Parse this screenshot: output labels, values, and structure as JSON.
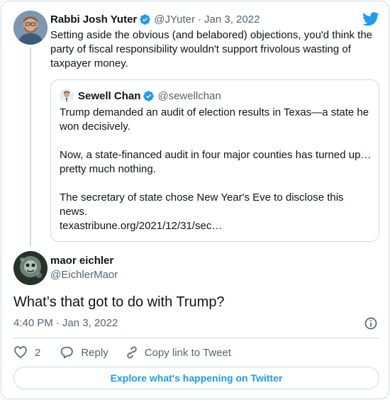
{
  "parent_tweet": {
    "name": "Rabbi Josh Yuter",
    "handle": "@JYuter",
    "separator": "·",
    "date": "Jan 3, 2022",
    "text": "Setting aside the obvious (and belabored) objections, you'd think the party of fiscal responsibility wouldn't support frivolous wasting of taxpayer money."
  },
  "quoted_tweet": {
    "name": "Sewell Chan",
    "handle": "@sewellchan",
    "paragraphs": [
      "Trump demanded an audit of election results in Texas—a state he won decisively.",
      "Now, a state-financed audit in four major counties has turned up…pretty much nothing.",
      "The secretary of state chose New Year's Eve to disclose this news."
    ],
    "link": "texastribune.org/2021/12/31/sec…"
  },
  "main_tweet": {
    "name": "maor eichler",
    "handle": "@EichlerMaor",
    "text": "What’s that got to do with Trump?",
    "time": "4:40 PM",
    "separator": "·",
    "date": "Jan 3, 2022"
  },
  "actions": {
    "like_count": "2",
    "reply_label": "Reply",
    "copy_link_label": "Copy link to Tweet"
  },
  "explore_label": "Explore what's happening on Twitter",
  "colors": {
    "accent": "#1d9bf0",
    "text": "#0f1419",
    "secondary": "#536471",
    "border": "#cfd9de"
  },
  "icons": [
    "verified-badge-icon",
    "twitter-bird-icon",
    "info-icon",
    "heart-icon",
    "reply-bubble-icon",
    "link-icon"
  ]
}
